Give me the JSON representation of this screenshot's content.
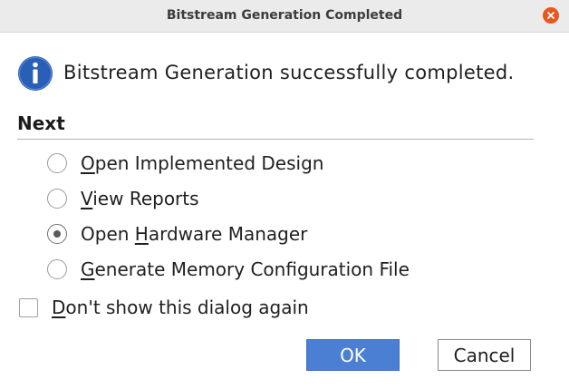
{
  "window": {
    "title": "Bitstream Generation Completed"
  },
  "message": {
    "icon": "info-icon",
    "text": "Bitstream Generation successfully completed."
  },
  "next": {
    "title": "Next",
    "options": [
      {
        "mnemonic": "O",
        "rest": "pen Implemented Design",
        "label": "Open Implemented Design",
        "selected": false
      },
      {
        "mnemonic": "V",
        "rest": "iew Reports",
        "label": "View Reports",
        "selected": false
      },
      {
        "before": "Open ",
        "mnemonic": "H",
        "rest": "ardware Manager",
        "label": "Open Hardware Manager",
        "selected": true
      },
      {
        "mnemonic": "G",
        "rest": "enerate Memory Configuration File",
        "label": "Generate Memory Configuration File",
        "selected": false
      }
    ]
  },
  "dont_show": {
    "mnemonic": "D",
    "rest": "on't show this dialog again",
    "label": "Don't show this dialog again",
    "checked": false
  },
  "buttons": {
    "ok": "OK",
    "cancel": "Cancel"
  },
  "colors": {
    "close_button": "#e9571f",
    "info_icon": "#2a5fb8",
    "ok_button": "#4a7fd4"
  }
}
